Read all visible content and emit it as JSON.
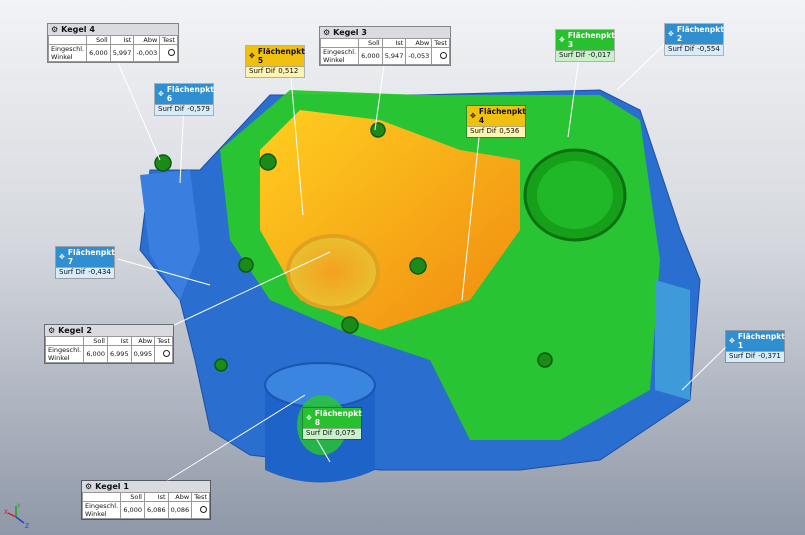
{
  "colors": {
    "blue": "#2f8fd0",
    "green": "#28c02f",
    "yellow": "#f0c010"
  },
  "kegel_columns": [
    "Soll",
    "Ist",
    "Abw",
    "Test"
  ],
  "kegel": [
    {
      "title": "Kegel 4",
      "label": "Eingeschl. Winkel",
      "soll": "6,000",
      "ist": "5,997",
      "abw": "-0,003"
    },
    {
      "title": "Kegel 3",
      "label": "Eingeschl. Winkel",
      "soll": "6,000",
      "ist": "5,947",
      "abw": "-0,053"
    },
    {
      "title": "Kegel 2",
      "label": "Eingeschl. Winkel",
      "soll": "6,000",
      "ist": "6,995",
      "abw": "0,995"
    },
    {
      "title": "Kegel 1",
      "label": "Eingeschl. Winkel",
      "soll": "6,000",
      "ist": "6,086",
      "abw": "0,086"
    }
  ],
  "flaechen": [
    {
      "title": "Flächenpkt 6",
      "label": "Surf Dif",
      "value": "-0,579"
    },
    {
      "title": "Flächenpkt 5",
      "label": "Surf Dif",
      "value": "0,512"
    },
    {
      "title": "Flächenpkt 3",
      "label": "Surf Dif",
      "value": "-0,017"
    },
    {
      "title": "Flächenpkt 2",
      "label": "Surf Dif",
      "value": "-0,554"
    },
    {
      "title": "Flächenpkt 4",
      "label": "Surf Dif",
      "value": "0,536"
    },
    {
      "title": "Flächenpkt 7",
      "label": "Surf Dif",
      "value": "-0,434"
    },
    {
      "title": "Flächenpkt 1",
      "label": "Surf Dif",
      "value": "-0,371"
    },
    {
      "title": "Flächenpkt 8",
      "label": "Surf Dif",
      "value": "0,075"
    }
  ],
  "axes": {
    "x": "X",
    "y": "Y",
    "z": "Z"
  }
}
